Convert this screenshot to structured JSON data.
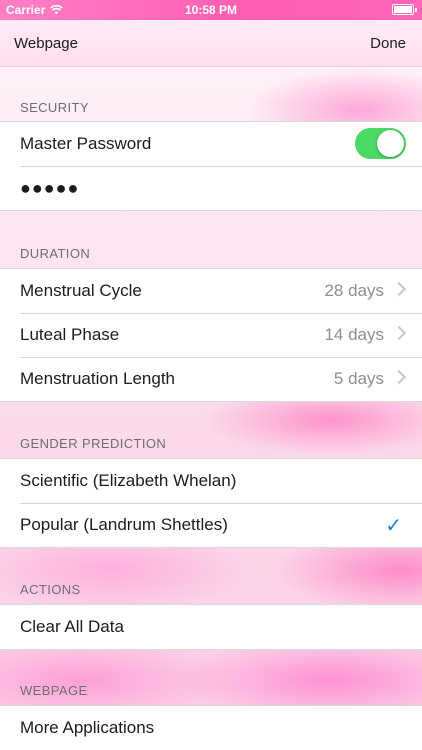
{
  "status_bar": {
    "carrier": "Carrier",
    "time": "10:58 PM"
  },
  "nav": {
    "left": "Webpage",
    "right": "Done"
  },
  "sections": {
    "security": {
      "header": "SECURITY",
      "master_password_label": "Master Password",
      "master_password_on": true,
      "password_value": "●●●●●"
    },
    "duration": {
      "header": "DURATION",
      "rows": [
        {
          "label": "Menstrual Cycle",
          "value": "28 days"
        },
        {
          "label": "Luteal Phase",
          "value": "14 days"
        },
        {
          "label": "Menstruation Length",
          "value": "5 days"
        }
      ]
    },
    "gender_prediction": {
      "header": "GENDER PREDICTION",
      "options": [
        {
          "label": "Scientific (Elizabeth Whelan)",
          "selected": false
        },
        {
          "label": "Popular (Landrum Shettles)",
          "selected": true
        }
      ],
      "check_symbol": "✓"
    },
    "actions": {
      "header": "ACTIONS",
      "clear_label": "Clear All Data"
    },
    "webpage": {
      "header": "WEBPAGE",
      "more_label": "More Applications"
    }
  },
  "colors": {
    "toggle_on": "#4cd964",
    "checkmark": "#1a7fd6",
    "status_bar": "#ff5db2"
  }
}
